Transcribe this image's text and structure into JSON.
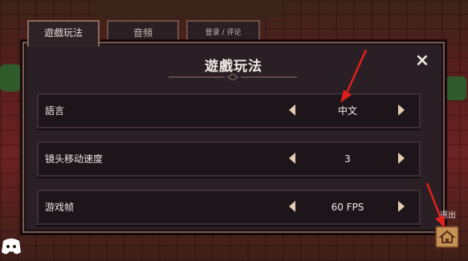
{
  "tabs": [
    {
      "label": "遊戲玩法",
      "active": true
    },
    {
      "label": "音頻",
      "active": false
    },
    {
      "label": "登录 / 评论",
      "active": false
    }
  ],
  "dialog": {
    "title": "遊戲玩法",
    "close_icon": "×"
  },
  "settings": [
    {
      "label": "語言",
      "value": "中文"
    },
    {
      "label": "镜头移动速度",
      "value": "3"
    },
    {
      "label": "游戏帧",
      "value": "60 FPS"
    }
  ],
  "exit": {
    "label": "退出"
  },
  "colors": {
    "frame": "#7a5b4e",
    "panel": "#2a1f24",
    "row_bg": "#1d1519",
    "arrow": "#e3cdb4",
    "home_button": "#c69254",
    "annotation": "#e0201c"
  }
}
